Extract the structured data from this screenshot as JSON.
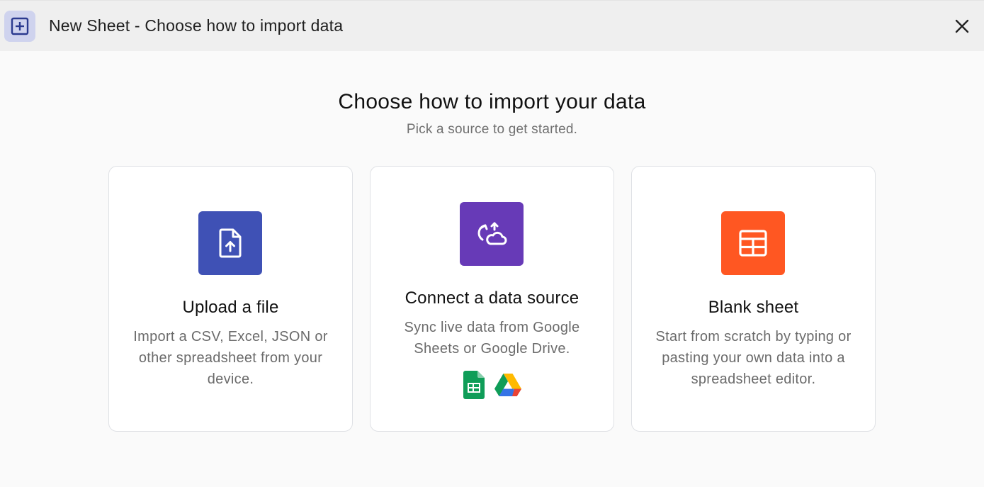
{
  "window": {
    "title": "New Sheet - Choose how to import data"
  },
  "main": {
    "heading": "Choose how to import your data",
    "subheading": "Pick a source to get started."
  },
  "cards": [
    {
      "title": "Upload a file",
      "description": "Import a CSV, Excel, JSON or other spreadsheet from your device.",
      "icon": "file-upload-icon",
      "color": "#3f51b5"
    },
    {
      "title": "Connect a data source",
      "description": "Sync live data from Google Sheets or Google Drive.",
      "icon": "cloud-sync-icon",
      "color": "#673ab7",
      "sources": [
        "google-sheets-icon",
        "google-drive-icon"
      ]
    },
    {
      "title": "Blank sheet",
      "description": "Start from scratch by typing or pasting your own data into a spreadsheet editor.",
      "icon": "table-icon",
      "color": "#ff5722"
    }
  ],
  "colors": {
    "titlebar_bg": "#efefef",
    "app_icon_bg": "#cfd3ee",
    "app_icon_fg": "#2b3a8f",
    "page_bg": "#fafafa"
  }
}
